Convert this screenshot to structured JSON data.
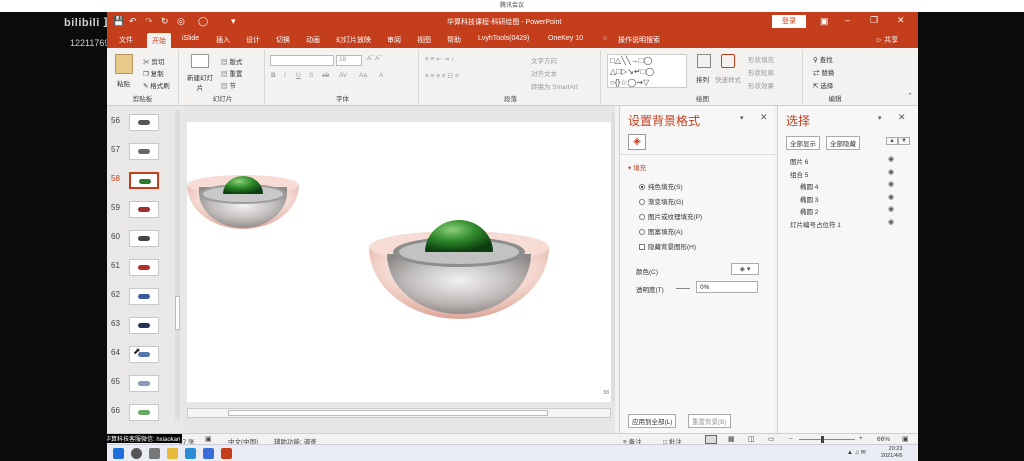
{
  "meeting_title": "腾讯会议",
  "watermark": {
    "brand": "bilibili 直播",
    "id": "12211769"
  },
  "titlebar": {
    "title": "华算科技课程-科研绘图 - PowerPoint",
    "login": "登录"
  },
  "tabs": [
    "文件",
    "开始",
    "iSlide",
    "插入",
    "设计",
    "切换",
    "动画",
    "幻灯片放映",
    "审阅",
    "视图",
    "帮助",
    "LvyhTools(0429)",
    "OneKey 10",
    "操作说明搜索"
  ],
  "share": "共享",
  "ribbon": {
    "clipboard": {
      "paste": "粘贴",
      "cut": "剪切",
      "copy": "复制",
      "format_painter": "格式刷",
      "label": "剪贴板"
    },
    "slides": {
      "new_slide": "新建幻灯片",
      "layout": "版式",
      "reset": "重置",
      "section": "节",
      "label": "幻灯片"
    },
    "font": {
      "size": "18",
      "label": "字体"
    },
    "paragraph": {
      "text_direction": "文字方向",
      "align_text": "对齐文本",
      "smartart": "转换为 SmartArt",
      "label": "段落"
    },
    "drawing": {
      "arrange": "排列",
      "quick_styles": "快速样式",
      "fill": "形状填充",
      "outline": "形状轮廓",
      "effects": "形状效果",
      "label": "绘图"
    },
    "editing": {
      "find": "查找",
      "replace": "替换",
      "select": "选择",
      "label": "编辑"
    }
  },
  "thumbnails": [
    {
      "num": "56",
      "selected": false
    },
    {
      "num": "57",
      "selected": false
    },
    {
      "num": "58",
      "selected": true
    },
    {
      "num": "59",
      "selected": false
    },
    {
      "num": "60",
      "selected": false
    },
    {
      "num": "61",
      "selected": false
    },
    {
      "num": "62",
      "selected": false
    },
    {
      "num": "63",
      "selected": false
    },
    {
      "num": "64",
      "selected": false
    },
    {
      "num": "65",
      "selected": false
    },
    {
      "num": "66",
      "selected": false
    }
  ],
  "slide_number": "58",
  "format_pane": {
    "title": "设置背景格式",
    "section": "填充",
    "options": [
      "纯色填充(S)",
      "渐变填充(G)",
      "图片或纹理填充(P)",
      "图案填充(A)"
    ],
    "hide_graphics": "隐藏背景图形(H)",
    "color_label": "颜色(C)",
    "transparency_label": "透明度(T)",
    "transparency_value": "0%",
    "apply_all": "应用到全部(L)",
    "reset_bg": "重置背景(B)"
  },
  "selection_pane": {
    "title": "选择",
    "show_all": "全部显示",
    "hide_all": "全部隐藏",
    "items": [
      {
        "label": "图片 6",
        "indent": 0
      },
      {
        "label": "组合 5",
        "indent": 0
      },
      {
        "label": "椭圆 4",
        "indent": 2
      },
      {
        "label": "椭圆 3",
        "indent": 2
      },
      {
        "label": "椭圆 2",
        "indent": 2
      },
      {
        "label": "灯片编号占位符 1",
        "indent": 0
      }
    ]
  },
  "status": {
    "slide_info": "97 张",
    "language": "中文(中国)",
    "accessibility": "辅助功能: 调查",
    "notes": "备注",
    "comments": "批注",
    "zoom": "66%",
    "overlay": "华算科技客服微信: hxiaokan"
  },
  "taskbar": {
    "time": "20:23",
    "date": "2021/4/6"
  }
}
